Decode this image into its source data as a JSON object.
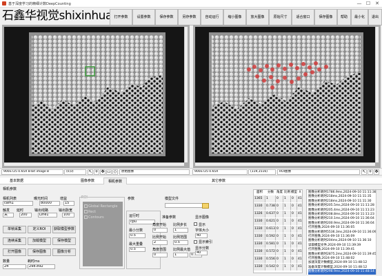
{
  "window": {
    "title": "基于深度学习的精细计数DeepCounting",
    "minimize": "—",
    "maximize": "☐",
    "close": "✕"
  },
  "brand": "石鑫华视觉shixinhua.com",
  "toolbar": [
    "打开参数",
    "设置参数",
    "保存参数",
    "另存参数",
    "自动运行",
    "缩小图像",
    "放大图像",
    "原始尺寸",
    "适合窗口",
    "保存图像",
    "帮助",
    "最小化",
    "退出"
  ],
  "status": {
    "left_info": "900x725 0.65X 8-bit image 8",
    "left_coords": "(0,0)",
    "left_label": "原始图像",
    "right_info": "900x725 0.65X",
    "right_coords": "(119,1516)",
    "right_label": "ROI图像"
  },
  "tabs": {
    "basic": "基本数据",
    "camera": "相机参数",
    "image": "图像参数",
    "other": "其它参数"
  },
  "camera_panel": {
    "group": "相机参数",
    "camera_list_label": "相机列表",
    "camera_value": "cam1",
    "exposure_label": "曝光时间",
    "exposure_value": "80000",
    "gain_label": "增益",
    "gain_value": "15",
    "trigger_label": "触发",
    "delay_label": "延时",
    "output_line_label": "输出线路",
    "output_delay_label": "输出脉宽",
    "trigger_value": "关",
    "delay_value": "200",
    "line_value": "Line1",
    "width_value": "100",
    "buttons": [
      "单帧采集",
      "定义ROI",
      "获取模型参数",
      "连续采集",
      "加载模型",
      "保存模型",
      "打开图像",
      "保存图像",
      "图像分析"
    ],
    "count_label": "数量",
    "time_label": "耗时ms",
    "count_value": "24",
    "time_value": "298.892"
  },
  "image_panel": {
    "roi_label": "ROI",
    "roi_items": [
      "Global Rectangle",
      "Rect",
      "Contours"
    ],
    "params_label": "参数",
    "model_file_label": "模型文件",
    "run_label": "运行时",
    "run_value": "cpu",
    "min_score_label": "最小分数",
    "min_score_value": "0.5",
    "max_overlap_label": "最大重叠",
    "max_overlap_value": "0.5",
    "prep_label": "准备参数",
    "ratio_start_label": "角度开始",
    "ratio_start_value": "0",
    "ratio_step_label": "比例步长",
    "ratio_step_value": "1",
    "angle_start_label": "比例开始",
    "angle_start_value": "2",
    "angle_range_label": "比例范围",
    "angle_range_value": "0.5",
    "scale_stop_label": "角度范围",
    "scale_stop_value": "0",
    "scale_max_label": "比例最大值",
    "scale_max_value": "1",
    "zero_step_value": "0.1",
    "display_label": "显示图像",
    "show_label": "显示",
    "font_size_label": "字体大小",
    "font_size_value": "40",
    "show_index_label": "显示索引",
    "show_score_label": "显示分数",
    "show_score_value": "40"
  },
  "results": {
    "headers": [
      "面积",
      "分数",
      "角度",
      "比例",
      "模型",
      "X",
      "Y"
    ],
    "rows": [
      [
        "1365",
        "1",
        "0",
        "1",
        "0",
        "416.2",
        "329.0"
      ],
      [
        "1330",
        "0.738",
        "0",
        "1",
        "0",
        "416.2",
        "374.0"
      ],
      [
        "1326",
        "0.637",
        "0",
        "1",
        "0",
        "416.2",
        "439.0"
      ],
      [
        "1330",
        "0.621",
        "0",
        "1",
        "0",
        "416.2",
        "509.0"
      ],
      [
        "1330",
        "0.613",
        "0",
        "1",
        "0",
        "416.2",
        "576.0"
      ],
      [
        "1330",
        "0.592",
        "0",
        "1",
        "0",
        "416.2",
        "646.0"
      ],
      [
        "1330",
        "0.581",
        "0",
        "1",
        "0",
        "416.2",
        "711.0"
      ],
      [
        "1330",
        "0.572",
        "0",
        "1",
        "0",
        "416.2",
        "776.0"
      ],
      [
        "1330",
        "0.556",
        "0",
        "1",
        "0",
        "416.2",
        "847.0"
      ],
      [
        "1330",
        "0.542",
        "0",
        "1",
        "0",
        "416.2",
        "913.0"
      ]
    ]
  },
  "log": [
    "图像分析耗时1786.9ms,2024-09-10 11:11:38",
    "图像分析耗时218ms,2024-09-10 11:11:35",
    "图像分析耗时218ms,2024-09-10 11:11:30",
    "图像分析耗时205.5ms,2024-09-10 11:11:28",
    "图像分析耗时205.4ms,2024-09-10 11:11:23",
    "图像分析耗时208.8ms,2024-09-10 11:11:23",
    "图像分析耗时210.1ms,2024-09-10 11:36:04",
    "图像分析耗时200.9ms,2024-09-10 11:36:04",
    "打开图像,2024-09-10 11:36:05",
    "图像分析耗时5536.3ms,2024-09-10 11:36:09",
    "打开图像,2024-09-10 11:36:09",
    "图像分析耗时204ms,2024-09-10 11:36:10",
    "读取模型文件,2024-09-10 11:39:39",
    "打开图像,2024-09-10 11:39:41",
    "图像分析耗时2875.2ms,2024-09-10 11:39:45",
    "打开图像,2024-09-10 11:48:02",
    "加速深度计数模型,2024-09-10 11:48:12",
    "准备深度计数模型,2024-09-10 11:48:12",
    "图像分析耗时298.9ms,2024-09-10 11:48:14"
  ],
  "colors": {
    "accent": "#316ac5",
    "detect": "#d23c3c",
    "roi_box": "#3c9a3c"
  }
}
